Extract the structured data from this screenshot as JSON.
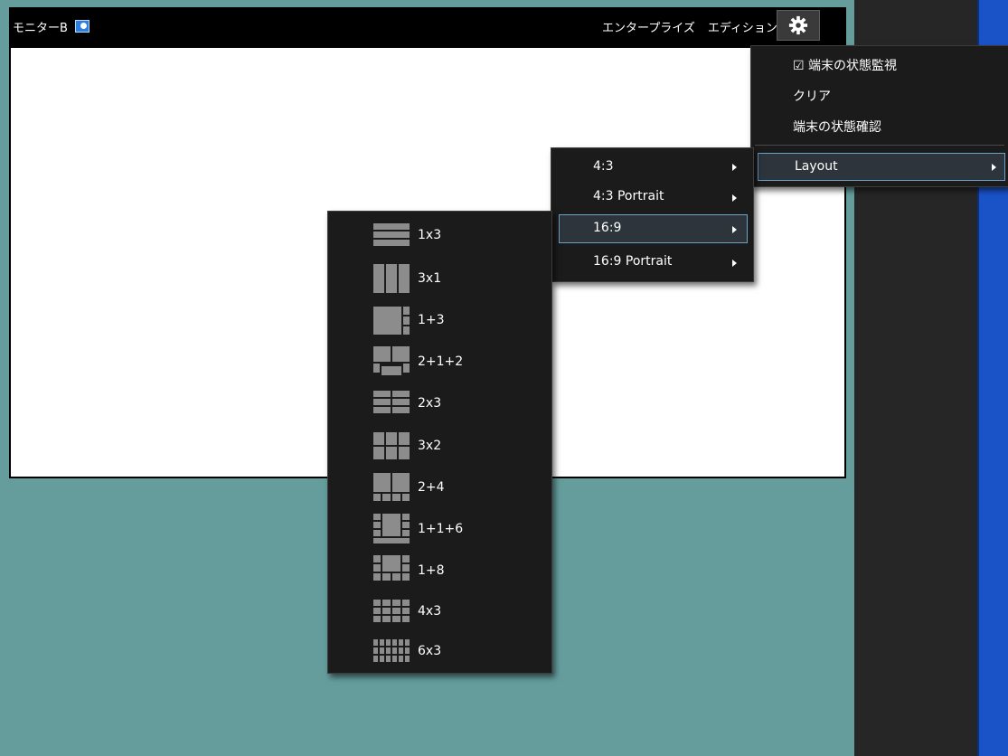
{
  "monitor": {
    "title": "モニターB",
    "edition": [
      "エンタープライズ",
      "エディション"
    ]
  },
  "settings_menu": {
    "items": [
      {
        "label": "☑ 端末の状態監視"
      },
      {
        "label": "クリア"
      },
      {
        "label": "端末の状態確認"
      }
    ],
    "layout_label": "Layout"
  },
  "aspect_menu": {
    "items": [
      {
        "label": "4:3"
      },
      {
        "label": "4:3 Portrait"
      },
      {
        "label": "16:9",
        "selected": true
      },
      {
        "label": "16:9 Portrait"
      }
    ]
  },
  "layout_menu": {
    "items": [
      {
        "label": "1x3",
        "icon": "layout-1x3-icon"
      },
      {
        "label": "3x1",
        "icon": "layout-3x1-icon"
      },
      {
        "label": "1+3",
        "icon": "layout-1plus3-icon"
      },
      {
        "label": "2+1+2",
        "icon": "layout-2plus1plus2-icon"
      },
      {
        "label": "2x3",
        "icon": "layout-2x3-icon"
      },
      {
        "label": "3x2",
        "icon": "layout-3x2-icon"
      },
      {
        "label": "2+4",
        "icon": "layout-2plus4-icon"
      },
      {
        "label": "1+1+6",
        "icon": "layout-1plus1plus6-icon"
      },
      {
        "label": "1+8",
        "icon": "layout-1plus8-icon"
      },
      {
        "label": "4x3",
        "icon": "layout-4x3-icon"
      },
      {
        "label": "6x3",
        "icon": "layout-6x3-icon"
      }
    ]
  },
  "colors": {
    "background": "#659d9d",
    "menu_bg": "#1b1b1b",
    "highlight_border": "#6aa3c8",
    "icon_gray": "#8c8c8c"
  }
}
